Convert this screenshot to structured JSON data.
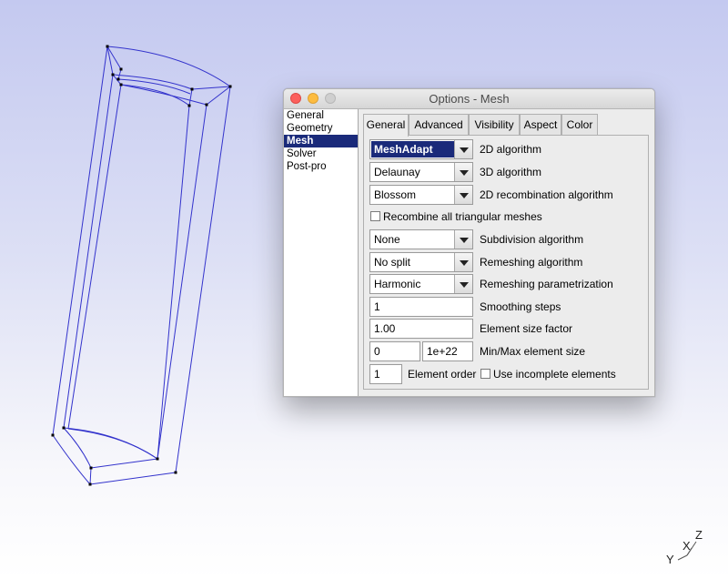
{
  "window": {
    "title": "Options - Mesh"
  },
  "categories": [
    {
      "label": "General",
      "selected": false
    },
    {
      "label": "Geometry",
      "selected": false
    },
    {
      "label": "Mesh",
      "selected": true
    },
    {
      "label": "Solver",
      "selected": false
    },
    {
      "label": "Post-pro",
      "selected": false
    }
  ],
  "tabs": [
    {
      "label": "General",
      "active": true
    },
    {
      "label": "Advanced",
      "active": false
    },
    {
      "label": "Visibility",
      "active": false
    },
    {
      "label": "Aspect",
      "active": false
    },
    {
      "label": "Color",
      "active": false
    }
  ],
  "general": {
    "algorithm_2d": {
      "value": "MeshAdapt",
      "label": "2D algorithm"
    },
    "algorithm_3d": {
      "value": "Delaunay",
      "label": "3D algorithm"
    },
    "recombination_2d": {
      "value": "Blossom",
      "label": "2D recombination algorithm"
    },
    "recombine_all": {
      "label": "Recombine all triangular meshes",
      "checked": false
    },
    "subdivision": {
      "value": "None",
      "label": "Subdivision algorithm"
    },
    "remeshing": {
      "value": "No split",
      "label": "Remeshing algorithm"
    },
    "remeshing_param": {
      "value": "Harmonic",
      "label": "Remeshing parametrization"
    },
    "smoothing_steps": {
      "value": "1",
      "label": "Smoothing steps"
    },
    "size_factor": {
      "value": "1.00",
      "label": "Element size factor"
    },
    "min_max_size": {
      "min": "0",
      "max": "1e+22",
      "label": "Min/Max element size"
    },
    "element_order": {
      "value": "1",
      "label": "Element order"
    },
    "incomplete": {
      "label": "Use incomplete elements",
      "checked": false
    }
  },
  "axes": {
    "x": "X",
    "y": "Y",
    "z": "Z"
  },
  "colors": {
    "geometry_line": "#3333cc",
    "geometry_point": "#000000",
    "selection": "#1a2a7a",
    "close": "#fc605c",
    "minimize": "#fdbc40",
    "maximize": "#cfcfcf"
  }
}
